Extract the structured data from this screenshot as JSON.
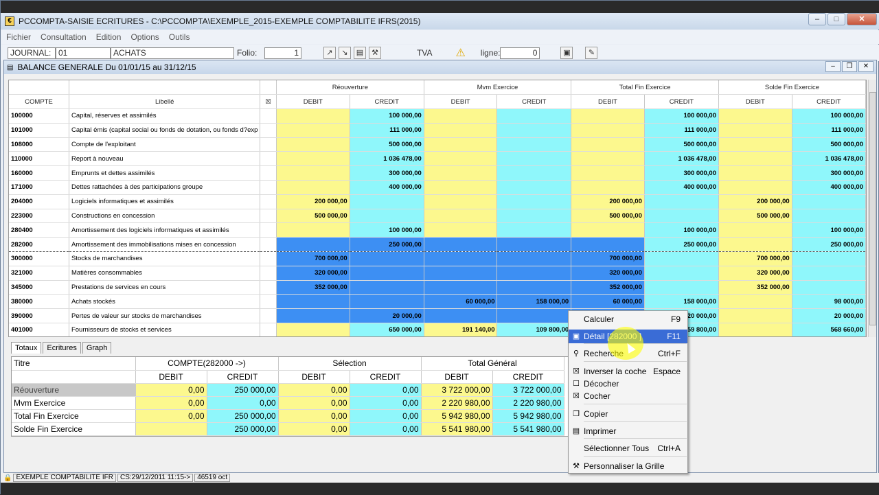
{
  "app": {
    "title": "PCCOMPTA-SAISIE ECRITURES - C:\\PCCOMPTA\\EXEMPLE_2015-EXEMPLE COMPTABILITE IFRS(2015)",
    "menu": [
      "Fichier",
      "Consultation",
      "Edition",
      "Options",
      "Outils"
    ]
  },
  "toolbar": {
    "journal_label": "JOURNAL:",
    "journal_value": "01",
    "journal_name": "ACHATS",
    "folio_label": "Folio:",
    "folio_value": "1",
    "tva_label": "TVA",
    "ligne_label": "ligne:",
    "ligne_value": "0"
  },
  "child": {
    "title": "BALANCE GENERALE Du 01/01/15 au 31/12/15"
  },
  "grid": {
    "group_headers": [
      "Réouverture",
      "Mvm Exercice",
      "Total Fin Exercice",
      "Solde Fin Exercice"
    ],
    "col_compte": "COMPTE",
    "col_libelle": "Libellé",
    "debit": "DEBIT",
    "credit": "CREDIT",
    "rows": [
      {
        "c": "100000",
        "l": "Capital, réserves et assimilés",
        "v": [
          "",
          "100 000,00",
          "",
          "",
          "",
          "100 000,00",
          "",
          "100 000,00"
        ]
      },
      {
        "c": "101000",
        "l": "Capital  émis (capital social ou fonds de dotation, ou fonds d?exp",
        "v": [
          "",
          "111 000,00",
          "",
          "",
          "",
          "111 000,00",
          "",
          "111 000,00"
        ]
      },
      {
        "c": "108000",
        "l": "Compte de l'exploitant",
        "v": [
          "",
          "500 000,00",
          "",
          "",
          "",
          "500 000,00",
          "",
          "500 000,00"
        ]
      },
      {
        "c": "110000",
        "l": "Report à nouveau",
        "v": [
          "",
          "1 036 478,00",
          "",
          "",
          "",
          "1 036 478,00",
          "",
          "1 036 478,00"
        ]
      },
      {
        "c": "160000",
        "l": "Emprunts et dettes assimilés",
        "v": [
          "",
          "300 000,00",
          "",
          "",
          "",
          "300 000,00",
          "",
          "300 000,00"
        ]
      },
      {
        "c": "171000",
        "l": "Dettes rattachées à des participations groupe",
        "v": [
          "",
          "400 000,00",
          "",
          "",
          "",
          "400 000,00",
          "",
          "400 000,00"
        ]
      },
      {
        "c": "204000",
        "l": "Logiciels informatiques et assimilés",
        "v": [
          "200 000,00",
          "",
          "",
          "",
          "200 000,00",
          "",
          "200 000,00",
          ""
        ]
      },
      {
        "c": "223000",
        "l": "Constructions en concession",
        "v": [
          "500 000,00",
          "",
          "",
          "",
          "500 000,00",
          "",
          "500 000,00",
          ""
        ]
      },
      {
        "c": "280400",
        "l": "Amortissement des logiciels informatiques et assimilés",
        "v": [
          "",
          "100 000,00",
          "",
          "",
          "",
          "100 000,00",
          "",
          "100 000,00"
        ]
      },
      {
        "c": "282000",
        "l": "Amortissement des immobilisations mises en concession",
        "v": [
          "",
          "250 000,00",
          "",
          "",
          "",
          "250 000,00",
          "",
          "250 000,00"
        ]
      },
      {
        "c": "300000",
        "l": "Stocks de marchandises",
        "v": [
          "700 000,00",
          "",
          "",
          "",
          "700 000,00",
          "",
          "700 000,00",
          ""
        ]
      },
      {
        "c": "321000",
        "l": "Matières consommables",
        "v": [
          "320 000,00",
          "",
          "",
          "",
          "320 000,00",
          "",
          "320 000,00",
          ""
        ]
      },
      {
        "c": "345000",
        "l": "Prestations de services en cours",
        "v": [
          "352 000,00",
          "",
          "",
          "",
          "352 000,00",
          "",
          "352 000,00",
          ""
        ]
      },
      {
        "c": "380000",
        "l": "Achats stockés",
        "v": [
          "",
          "",
          "60 000,00",
          "158 000,00",
          "60 000,00",
          "158 000,00",
          "",
          "98 000,00"
        ]
      },
      {
        "c": "390000",
        "l": "Pertes de valeur sur stocks de marchandises",
        "v": [
          "",
          "20 000,00",
          "",
          "",
          "",
          "20 000,00",
          "",
          "20 000,00"
        ]
      },
      {
        "c": "401000",
        "l": "Fournisseurs de stocks et services",
        "v": [
          "",
          "650 000,00",
          "191 140,00",
          "109 800,00",
          "",
          "59 800,00",
          "",
          "568 660,00"
        ]
      }
    ]
  },
  "tabs": [
    "Totaux",
    "Ecritures",
    "Graph"
  ],
  "totals": {
    "titre": "Titre",
    "groups": [
      "COMPTE(282000      ->)",
      "Sélection",
      "Total Général"
    ],
    "debit": "DEBIT",
    "credit": "CREDIT",
    "rows": [
      {
        "l": "Réouverture",
        "v": [
          "0,00",
          "250 000,00",
          "0,00",
          "0,00",
          "3 722 000,00",
          "3 722 000,00"
        ]
      },
      {
        "l": "Mvm Exercice",
        "v": [
          "0,00",
          "0,00",
          "0,00",
          "0,00",
          "2 220 980,00",
          "2 220 980,00"
        ]
      },
      {
        "l": "Total Fin Exercice",
        "v": [
          "0,00",
          "250 000,00",
          "0,00",
          "0,00",
          "5 942 980,00",
          "5 942 980,00"
        ]
      },
      {
        "l": "Solde Fin Exercice",
        "v": [
          "",
          "250 000,00",
          "0,00",
          "0,00",
          "5 541 980,00",
          "5 541 980,00"
        ]
      }
    ]
  },
  "context_menu": [
    {
      "label": "Calculer",
      "shortcut": "F9",
      "icon": "calculator-icon"
    },
    {
      "label": "Détail  [282000        ]",
      "shortcut": "F11",
      "icon": "detail-icon",
      "highlight": true
    },
    {
      "label": "Recherche",
      "shortcut": "Ctrl+F",
      "icon": "binoculars-icon"
    },
    {
      "label": "Inverser la coche",
      "shortcut": "Espace",
      "icon": "invert-check-icon"
    },
    {
      "label": "Décocher",
      "shortcut": "",
      "icon": "uncheck-icon"
    },
    {
      "label": "Cocher",
      "shortcut": "",
      "icon": "check-icon"
    },
    {
      "label": "Copier",
      "shortcut": "",
      "icon": "copy-icon"
    },
    {
      "label": "Imprimer",
      "shortcut": "",
      "icon": "print-icon"
    },
    {
      "label": "Sélectionner Tous",
      "shortcut": "Ctrl+A",
      "icon": ""
    },
    {
      "label": "Personnaliser la Grille",
      "shortcut": "",
      "icon": "tools-icon"
    }
  ],
  "status": {
    "company": "EXEMPLE COMPTABILITE IFR",
    "cs": "CS:29/12/2011 11:15->",
    "size": "46519 oct"
  }
}
